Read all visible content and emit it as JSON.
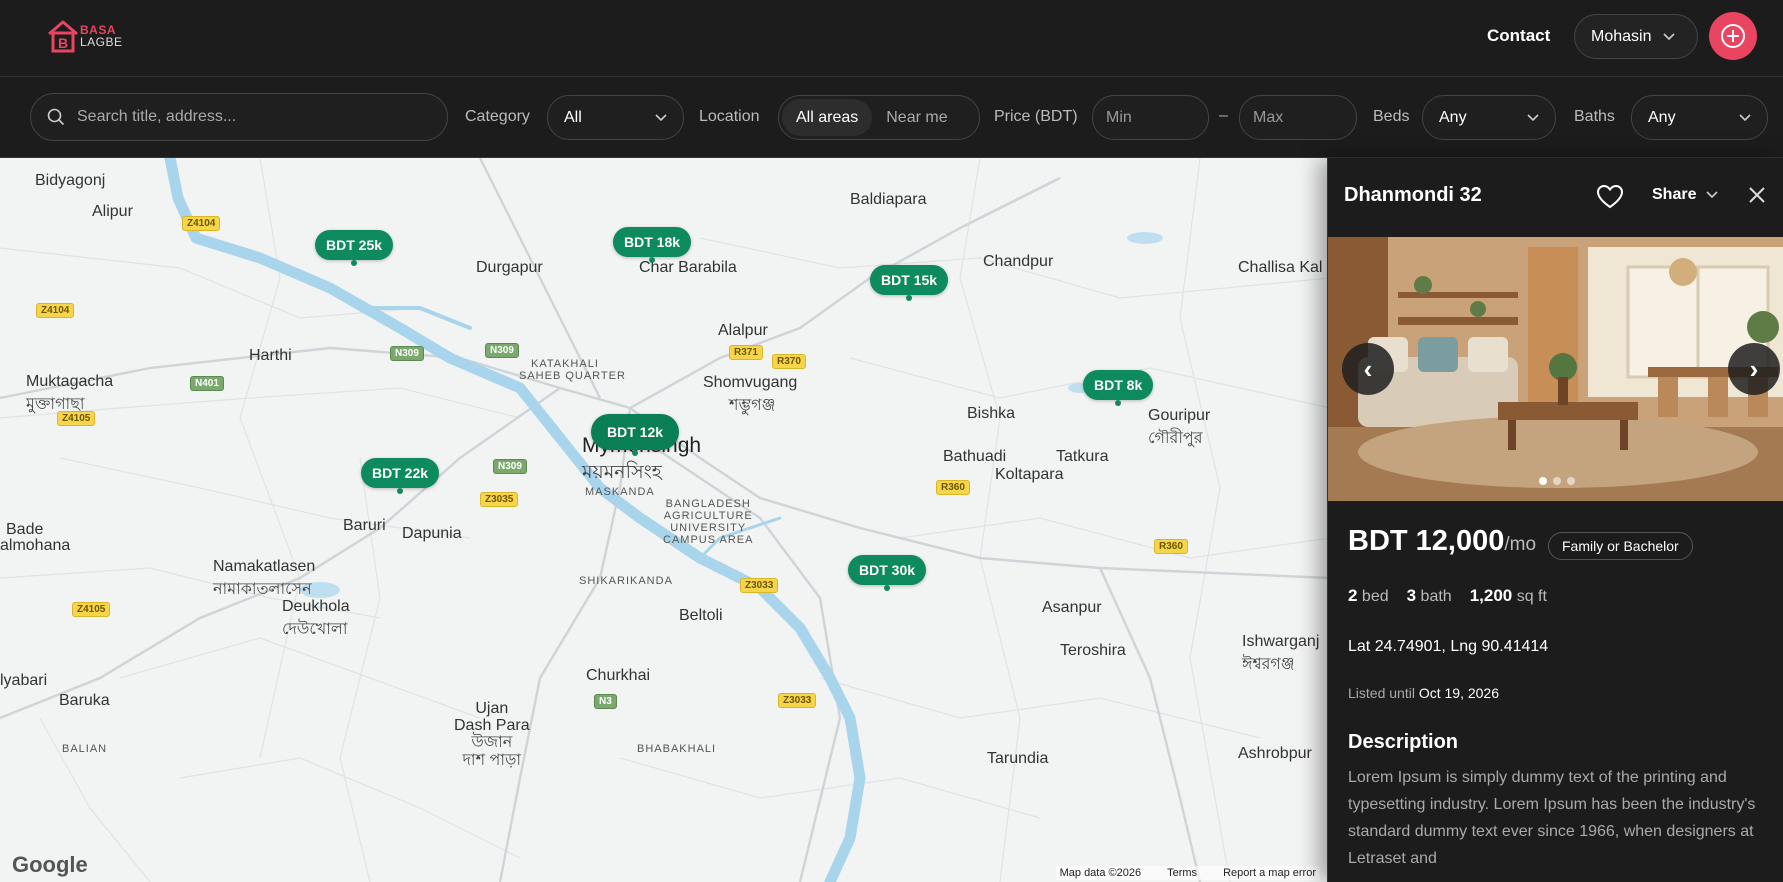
{
  "app": {
    "logo_line1": "BASA",
    "logo_line2": "LAGBE"
  },
  "header": {
    "contact": "Contact",
    "user": "Mohasin",
    "add_icon": "plus-circle-icon"
  },
  "filters": {
    "search_placeholder": "Search title, address...",
    "category_label": "Category",
    "category_value": "All",
    "location_label": "Location",
    "location_options": [
      "All areas",
      "Near me"
    ],
    "location_selected": "All areas",
    "price_label": "Price (BDT)",
    "price_min_placeholder": "Min",
    "price_max_placeholder": "Max",
    "price_separator": "–",
    "beds_label": "Beds",
    "beds_value": "Any",
    "baths_label": "Baths",
    "baths_value": "Any"
  },
  "map": {
    "places": [
      "Bidyagonj",
      "Alipur",
      "Baldiapara",
      "Durgapur",
      "Char Barabila",
      "Chandpur",
      "Challisa Kal",
      "Alalpur",
      "Harthi",
      "Muktagacha",
      "মুক্তাগাছা",
      "Shomvugang",
      "শম্ভুগঞ্জ",
      "Bishka",
      "Gouripur",
      "গৌরীপুর",
      "Mymensingh",
      "ময়মনসিংহ",
      "Bathuadi",
      "Tatkura",
      "Koltapara",
      "Bade",
      "almohana",
      "Baruri",
      "Dapunia",
      "Namakatlasen",
      "নামাকাতলাসেন",
      "Deukhola",
      "দেউখোলা",
      "Beltoli",
      "Asanpur",
      "Ishwarganj",
      "ঈশ্বরগঞ্জ",
      "Teroshira",
      "lyabari",
      "Baruka",
      "Churkhai",
      "Ujan",
      "Dash Para",
      "উজান",
      "দাশ পাড়া",
      "Tarundia",
      "Ashrobpur"
    ],
    "small_labels": [
      "KATAKHALI",
      "SAHEB QUARTER",
      "MASKANDA",
      "BANGLADESH",
      "AGRICULTURE",
      "UNIVERSITY",
      "CAMPUS AREA",
      "SHIKARIKANDA",
      "BHABAKHALI",
      "BALIAN"
    ],
    "road_shields": [
      "Z4104",
      "Z4104",
      "N309",
      "N309",
      "R371",
      "R370",
      "N401",
      "Z4105",
      "N309",
      "Z3035",
      "R360",
      "R360",
      "Z4105",
      "Z3033",
      "N3",
      "Z3033"
    ],
    "pins": [
      "BDT 25k",
      "BDT 18k",
      "BDT 15k",
      "BDT 8k",
      "BDT 12k",
      "BDT 22k",
      "BDT 30k"
    ],
    "selected_pin": "BDT 12k",
    "google_logo": "Google",
    "footer": [
      "Map data ©2026",
      "Terms",
      "Report a map error"
    ]
  },
  "listing": {
    "title": "Dhanmondi 32",
    "share": "Share",
    "price": "BDT 12,000",
    "per": "/mo",
    "tenant_badge": "Family or Bachelor",
    "beds_num": "2",
    "beds_unit": "bed",
    "baths_num": "3",
    "baths_unit": "bath",
    "area_num": "1,200",
    "area_unit": "sq ft",
    "coords": "Lat 24.74901, Lng 90.41414",
    "listed_label": "Listed until",
    "listed_date": "Oct 19, 2026",
    "description_heading": "Description",
    "description": "Lorem Ipsum is simply dummy text of the printing and typesetting industry. Lorem Ipsum has been the industry's standard dummy text ever since 1966, when designers at Letraset and",
    "photo_count": 3,
    "photo_current": 1
  },
  "colors": {
    "accent": "#e94560",
    "pin_green": "#0d8a5e",
    "background": "#1c1c1c"
  }
}
